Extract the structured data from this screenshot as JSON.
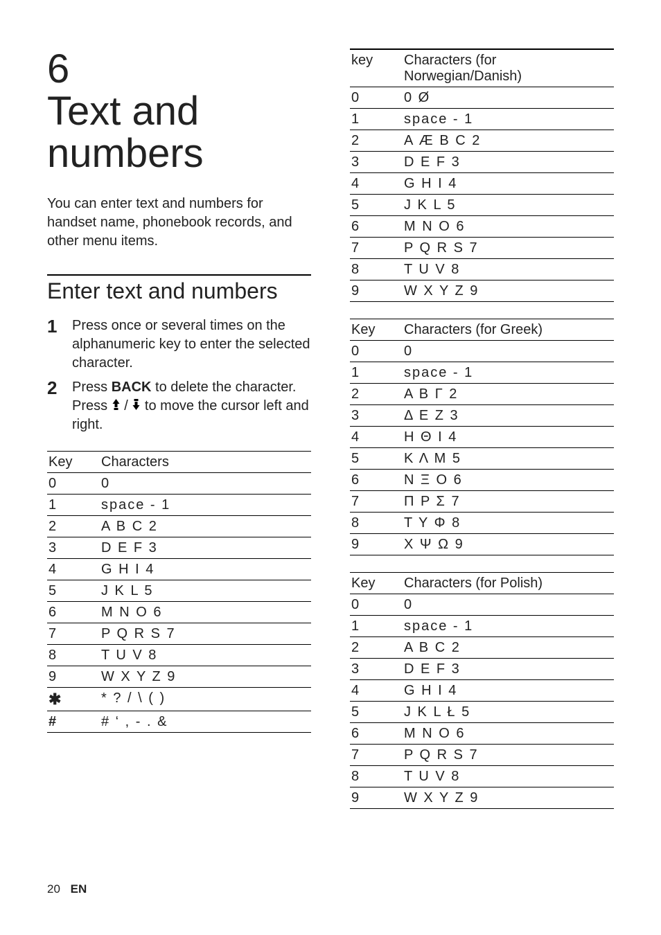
{
  "chapter": {
    "number": "6",
    "title": "Text and numbers"
  },
  "intro": "You can enter text and numbers for handset name, phonebook records, and other menu items.",
  "section_title": "Enter text and numbers",
  "steps": [
    {
      "num": "1",
      "text": "Press once or several times on the alphanumeric key to enter the selected character."
    },
    {
      "num": "2",
      "text_before": "Press ",
      "bold1": "BACK",
      "text_mid": " to delete the character. Press ",
      "text_after": " to move the cursor left and right."
    }
  ],
  "table_generic": {
    "header": {
      "key": "Key",
      "val": "Characters"
    },
    "rows": [
      {
        "key": "0",
        "val": "0"
      },
      {
        "key": "1",
        "val": "space - 1"
      },
      {
        "key": "2",
        "val": "A B C 2"
      },
      {
        "key": "3",
        "val": "D E F 3"
      },
      {
        "key": "4",
        "val": "G H I 4"
      },
      {
        "key": "5",
        "val": "J K L 5"
      },
      {
        "key": "6",
        "val": "M N O 6"
      },
      {
        "key": "7",
        "val": "P Q R S 7"
      },
      {
        "key": "8",
        "val": "T U V 8"
      },
      {
        "key": "9",
        "val": "W X Y Z 9"
      },
      {
        "key": "*",
        "val": "* ? / \\ ( )"
      },
      {
        "key": "#",
        "val": "# ‘ , - . &"
      }
    ]
  },
  "table_nordic": {
    "header": {
      "key": "key",
      "val": "Characters (for Norwegian/Danish)"
    },
    "rows": [
      {
        "key": "0",
        "val": "0 Ø"
      },
      {
        "key": "1",
        "val": "space - 1"
      },
      {
        "key": "2",
        "val": "A Æ B C 2"
      },
      {
        "key": "3",
        "val": "D E F 3"
      },
      {
        "key": "4",
        "val": "G H I 4"
      },
      {
        "key": "5",
        "val": "J K L 5"
      },
      {
        "key": "6",
        "val": "M N O 6"
      },
      {
        "key": "7",
        "val": "P Q R S 7"
      },
      {
        "key": "8",
        "val": "T U V 8"
      },
      {
        "key": "9",
        "val": "W X Y Z 9"
      }
    ]
  },
  "table_greek": {
    "header": {
      "key": "Key",
      "val": "Characters (for Greek)"
    },
    "rows": [
      {
        "key": "0",
        "val": "0"
      },
      {
        "key": "1",
        "val": "space - 1"
      },
      {
        "key": "2",
        "val": "Α Β Γ 2"
      },
      {
        "key": "3",
        "val": "Δ Ε Ζ 3"
      },
      {
        "key": "4",
        "val": "Η Θ Ι 4"
      },
      {
        "key": "5",
        "val": "Κ Λ Μ 5"
      },
      {
        "key": "6",
        "val": "Ν Ξ Ο 6"
      },
      {
        "key": "7",
        "val": "Π Ρ Σ 7"
      },
      {
        "key": "8",
        "val": "Τ Υ Φ 8"
      },
      {
        "key": "9",
        "val": "Χ Ψ Ω 9"
      }
    ]
  },
  "table_polish": {
    "header": {
      "key": "Key",
      "val": "Characters (for Polish)"
    },
    "rows": [
      {
        "key": "0",
        "val": "0"
      },
      {
        "key": "1",
        "val": "space - 1"
      },
      {
        "key": "2",
        "val": "A B C 2"
      },
      {
        "key": "3",
        "val": "D E F 3"
      },
      {
        "key": "4",
        "val": "G H I 4"
      },
      {
        "key": "5",
        "val": "J K L Ł 5"
      },
      {
        "key": "6",
        "val": "M N O 6"
      },
      {
        "key": "7",
        "val": "P Q R S 7"
      },
      {
        "key": "8",
        "val": "T U V 8"
      },
      {
        "key": "9",
        "val": "W X Y Z 9"
      }
    ]
  },
  "footer": {
    "page": "20",
    "lang": "EN"
  }
}
